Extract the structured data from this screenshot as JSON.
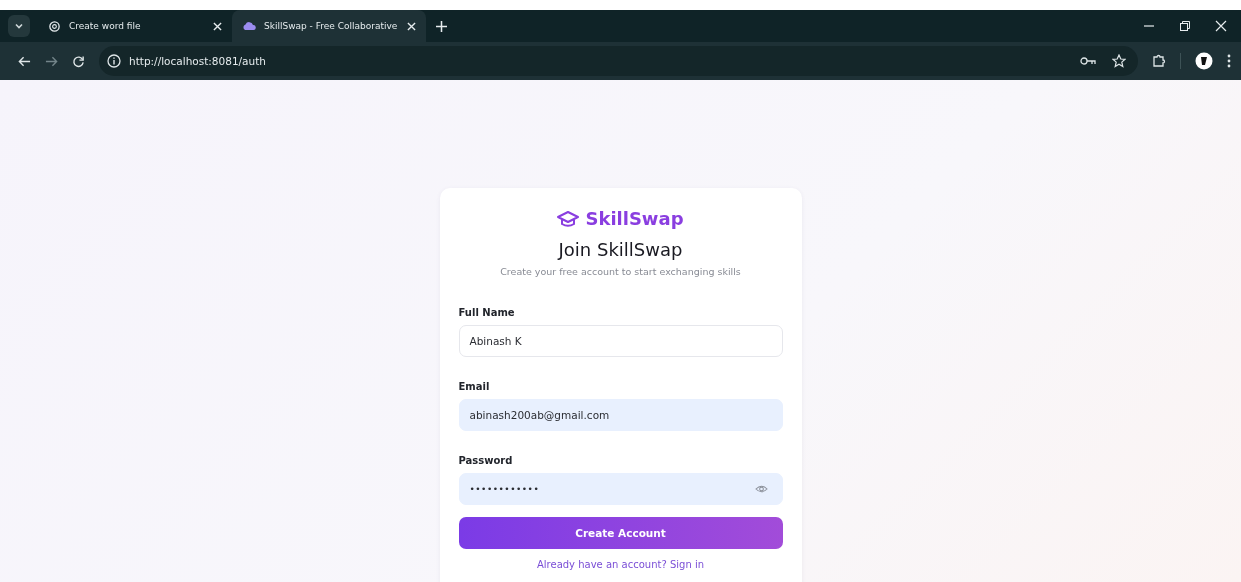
{
  "browser": {
    "tabs": [
      {
        "title": "Create word file",
        "selected": false
      },
      {
        "title": "SkillSwap - Free Collaborative",
        "selected": true
      }
    ],
    "address": "http://localhost:8081/auth"
  },
  "card": {
    "brand": "SkillSwap",
    "title": "Join SkillSwap",
    "subtitle": "Create your free account to start exchanging skills",
    "fields": [
      {
        "label": "Full Name",
        "value": "Abinash K",
        "autofilled": false,
        "kind": "text"
      },
      {
        "label": "Email",
        "value": "abinash200ab@gmail.com",
        "autofilled": true,
        "kind": "text"
      },
      {
        "label": "Password",
        "value": "••••••••••••",
        "autofilled": true,
        "kind": "password"
      }
    ],
    "submit": "Create Account",
    "footer_link": "Already have an account? Sign in"
  }
}
